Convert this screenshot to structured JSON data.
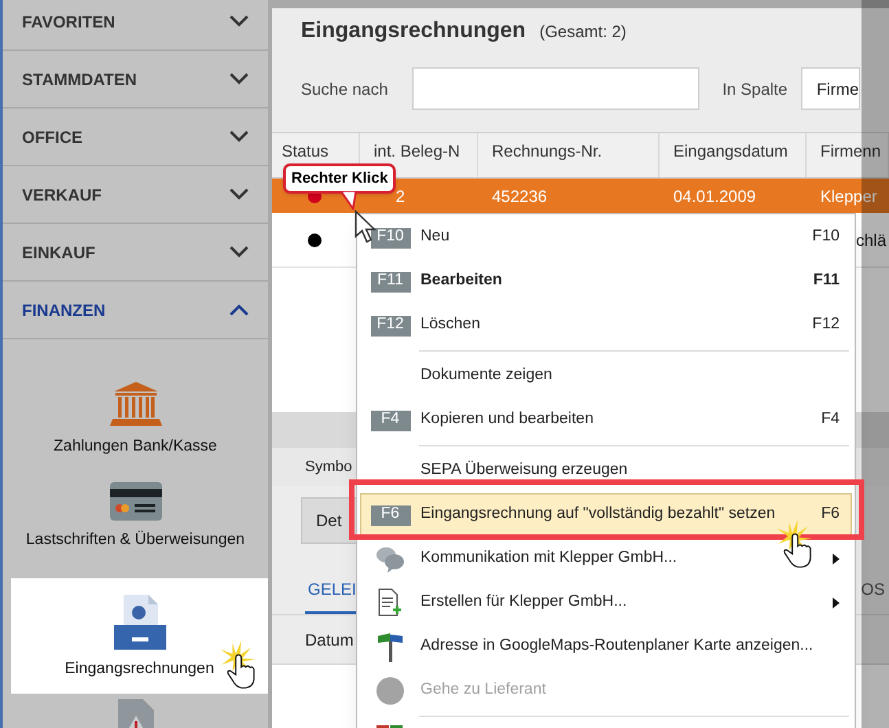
{
  "sidebar": {
    "sections": [
      {
        "label": "FAVORITEN",
        "expanded": false
      },
      {
        "label": "STAMMDATEN",
        "expanded": false
      },
      {
        "label": "OFFICE",
        "expanded": false
      },
      {
        "label": "VERKAUF",
        "expanded": false
      },
      {
        "label": "EINKAUF",
        "expanded": false
      },
      {
        "label": "FINANZEN",
        "expanded": true
      }
    ],
    "items": [
      {
        "kind": "bank",
        "label": "Zahlungen Bank/Kasse",
        "selected": false
      },
      {
        "kind": "card",
        "label": "Lastschriften & Überweisungen",
        "selected": false
      },
      {
        "kind": "inbox",
        "label": "Eingangsrechnungen",
        "selected": true
      },
      {
        "kind": "warning",
        "selected": false
      }
    ]
  },
  "main": {
    "title": "Eingangsrechnungen",
    "total": "(Gesamt: 2)",
    "search_label": "Suche nach",
    "column_label": "In Spalte",
    "column_value": "Firme",
    "table": {
      "columns": [
        "Status",
        "int. Beleg-N",
        "Rechnungs-Nr.",
        "Eingangsdatum",
        "Firmenn"
      ],
      "rows": [
        {
          "selected": true,
          "color": "#d0021b",
          "cells": [
            "",
            "2",
            "452236",
            "04.01.2009",
            "Klepper"
          ]
        },
        {
          "selected": false,
          "color": "#000000",
          "cells": [
            "",
            "",
            "",
            "",
            "chlä"
          ]
        }
      ]
    },
    "symbol_label": "Symbo",
    "details_button": "Det",
    "tabs": [
      {
        "label": "GELEI",
        "selected": true
      },
      {
        "label": "OS",
        "selected": false
      }
    ],
    "list_column": "Datum"
  },
  "callout": "Rechter Klick",
  "context_menu": [
    {
      "kind": "key",
      "badge": "F10",
      "label": "Neu",
      "shortcut": "F10",
      "bold": false,
      "selected": false,
      "disabled": false,
      "submenu": false
    },
    {
      "kind": "key",
      "badge": "F11",
      "label": "Bearbeiten",
      "shortcut": "F11",
      "bold": true,
      "selected": false,
      "disabled": false,
      "submenu": false
    },
    {
      "kind": "key",
      "badge": "F12",
      "label": "Löschen",
      "shortcut": "F12",
      "bold": false,
      "selected": false,
      "disabled": false,
      "submenu": false
    },
    {
      "kind": "separator"
    },
    {
      "kind": "plain",
      "label": "Dokumente zeigen",
      "bold": false,
      "selected": false,
      "disabled": false,
      "submenu": false
    },
    {
      "kind": "key",
      "badge": "F4",
      "label": "Kopieren und bearbeiten",
      "shortcut": "F4",
      "bold": false,
      "selected": false,
      "disabled": false,
      "submenu": false
    },
    {
      "kind": "separator"
    },
    {
      "kind": "plain",
      "label": "SEPA Überweisung erzeugen",
      "bold": false,
      "selected": false,
      "disabled": false,
      "submenu": false
    },
    {
      "kind": "key",
      "badge": "F6",
      "label": "Eingangsrechnung auf \"vollständig bezahlt\" setzen",
      "shortcut": "F6",
      "bold": false,
      "selected": true,
      "disabled": false,
      "submenu": false
    },
    {
      "kind": "chat",
      "label": "Kommunikation mit Klepper GmbH...",
      "bold": false,
      "selected": false,
      "disabled": false,
      "submenu": true
    },
    {
      "kind": "document",
      "label": "Erstellen für Klepper GmbH...",
      "bold": false,
      "selected": false,
      "disabled": false,
      "submenu": true
    },
    {
      "kind": "signpost",
      "label": "Adresse in GoogleMaps-Routenplaner Karte anzeigen...",
      "bold": false,
      "selected": false,
      "disabled": false,
      "submenu": false
    },
    {
      "kind": "circle",
      "label": "Gehe zu Lieferant",
      "bold": false,
      "selected": false,
      "disabled": true,
      "submenu": false
    },
    {
      "kind": "separator"
    },
    {
      "kind": "squares",
      "selected": false
    }
  ]
}
